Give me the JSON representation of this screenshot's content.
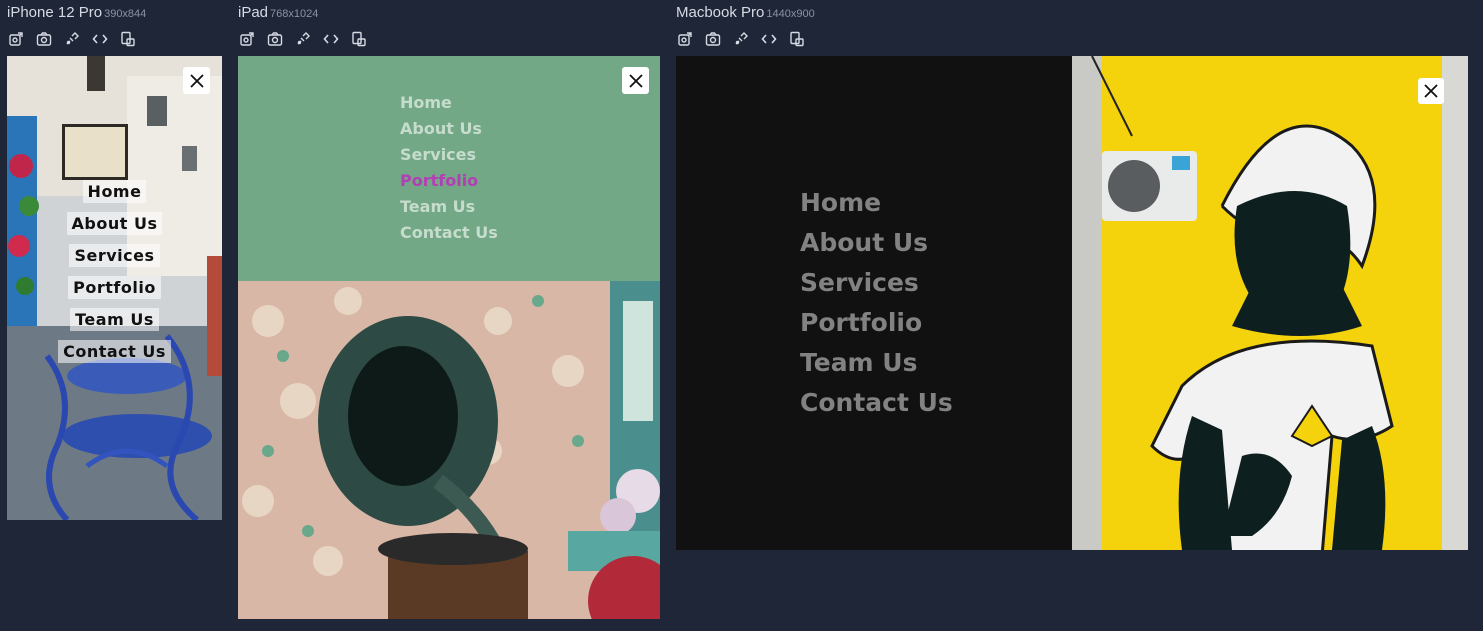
{
  "devices": {
    "iphone": {
      "name": "iPhone 12 Pro",
      "size": "390x844"
    },
    "ipad": {
      "name": "iPad",
      "size": "768x1024"
    },
    "mac": {
      "name": "Macbook Pro",
      "size": "1440x900"
    }
  },
  "toolbar_icons": [
    "rotate-icon",
    "screenshot-icon",
    "inspect-icon",
    "code-icon",
    "layout-icon"
  ],
  "menu": {
    "items": [
      "Home",
      "About Us",
      "Services",
      "Portfolio",
      "Team Us",
      "Contact Us"
    ],
    "active_on_ipad": "Portfolio"
  },
  "colors": {
    "background": "#1e2638",
    "ipad_menu_bg": "#72a885",
    "ipad_active": "#b23fb4",
    "mac_menu_bg": "#111111",
    "mac_photo_yellow": "#f4d20c"
  }
}
